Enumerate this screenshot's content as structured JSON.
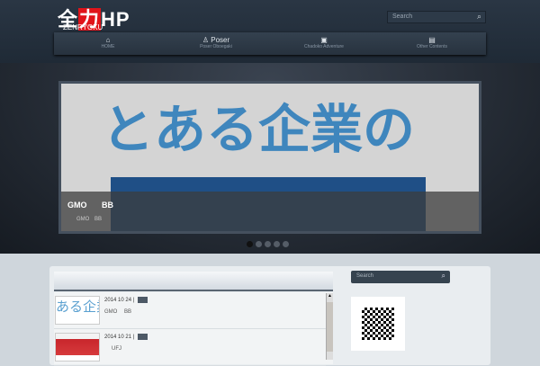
{
  "header": {
    "logo_main": "全",
    "logo_red": "力",
    "logo_hp": "HP",
    "logo_sub": "ZENRYOKU",
    "search_placeholder": "Search"
  },
  "nav": [
    {
      "icon": "⌂",
      "label": "HOME"
    },
    {
      "icon": "♙ Poser",
      "label": "Poser Oboegaki"
    },
    {
      "icon": "▣",
      "label": "Chadoko Adventure"
    },
    {
      "icon": "▤",
      "label": "Other Contents"
    }
  ],
  "slider": {
    "banner_text": "とある企業の",
    "caption_title": "GMO BB",
    "caption_text": "GMO BB",
    "slide_count": 5,
    "active_slide": 1
  },
  "posts": [
    {
      "thumb": "ある企業",
      "date": "2014 10 24 |",
      "text": "GMO BB"
    },
    {
      "thumb": "",
      "date": "2014 10 21 |",
      "text": "UFJ"
    }
  ],
  "sidebar": {
    "search_placeholder": "Search"
  }
}
